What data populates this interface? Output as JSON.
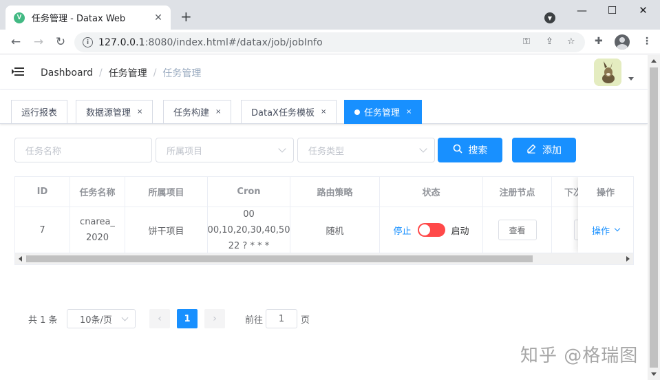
{
  "browser": {
    "tab_title": "任务管理 - Datax Web",
    "tab_close": "✕",
    "new_tab": "+",
    "url_host": "127.0.0.1",
    "url_rest": ":8080/index.html#/datax/job/jobInfo",
    "window_controls": [
      "—",
      "☐",
      "✕"
    ]
  },
  "breadcrumb": {
    "items": [
      "Dashboard",
      "任务管理",
      "任务管理"
    ],
    "separator": "/"
  },
  "tags": [
    {
      "label": "运行报表",
      "closable": false
    },
    {
      "label": "数据源管理",
      "closable": true
    },
    {
      "label": "任务构建",
      "closable": true
    },
    {
      "label": "DataX任务模板",
      "closable": true
    },
    {
      "label": "任务管理",
      "closable": true,
      "active": true
    }
  ],
  "tag_close": "×",
  "filters": {
    "name_placeholder": "任务名称",
    "project_placeholder": "所属项目",
    "type_placeholder": "任务类型",
    "search_label": "搜索",
    "add_label": "添加"
  },
  "table": {
    "headers": [
      "ID",
      "任务名称",
      "所属项目",
      "Cron",
      "路由策略",
      "状态",
      "注册节点",
      "下次",
      "操作"
    ],
    "rows": [
      {
        "id": "7",
        "name": "cnarea_2020",
        "project": "饼干项目",
        "cron": "00 00,10,20,30,40,50 22 ? * * *",
        "route": "随机",
        "status_inactive": "停止",
        "status_active": "启动",
        "status_on": false,
        "node_btn": "查看",
        "action": "操作"
      }
    ]
  },
  "pagination": {
    "total": "共 1 条",
    "page_size": "10条/页",
    "prev": "‹",
    "current": "1",
    "next": "›",
    "goto_label": "前往",
    "goto_value": "1",
    "page_suffix": "页"
  },
  "watermark": "知乎 @格瑞图",
  "colors": {
    "primary": "#1890ff",
    "switch_off": "#ff4949",
    "tab_bar": "#dee1e6"
  }
}
